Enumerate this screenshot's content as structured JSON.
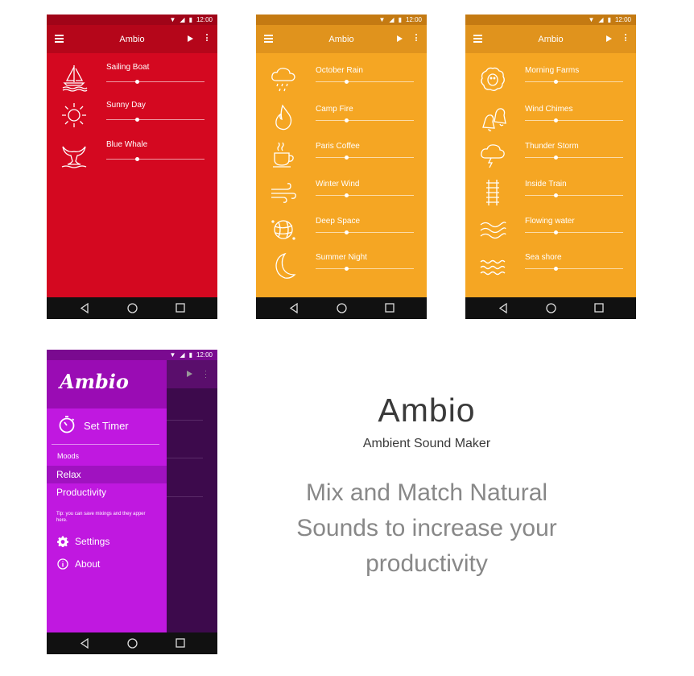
{
  "status_time": "12:00",
  "app_title": "Ambio",
  "screens": [
    {
      "bg": "#d40820",
      "bar": "#b5061a",
      "items": [
        {
          "label": "Sailing Boat",
          "icon": "sailboat-icon"
        },
        {
          "label": "Sunny Day",
          "icon": "sun-icon"
        },
        {
          "label": "Blue Whale",
          "icon": "whale-tail-icon"
        }
      ]
    },
    {
      "bg": "#f5a623",
      "bar": "#d9891a",
      "items": [
        {
          "label": "October Rain",
          "icon": "rain-cloud-icon"
        },
        {
          "label": "Camp Fire",
          "icon": "fire-icon"
        },
        {
          "label": "Paris Coffee",
          "icon": "coffee-cup-icon"
        },
        {
          "label": "Winter Wind",
          "icon": "wind-icon"
        },
        {
          "label": "Deep Space",
          "icon": "planet-icon"
        },
        {
          "label": "Summer Night",
          "icon": "moon-icon"
        }
      ]
    },
    {
      "bg": "#f5a623",
      "bar": "#d9891a",
      "items": [
        {
          "label": "Morning Farms",
          "icon": "sheep-icon"
        },
        {
          "label": "Wind Chimes",
          "icon": "bells-icon"
        },
        {
          "label": "Thunder Storm",
          "icon": "storm-cloud-icon"
        },
        {
          "label": "Inside Train",
          "icon": "train-track-icon"
        },
        {
          "label": "Flowing water",
          "icon": "water-waves-icon"
        },
        {
          "label": "Sea shore",
          "icon": "sea-waves-icon"
        }
      ]
    }
  ],
  "drawer": {
    "logo": "Ambio",
    "set_timer": "Set Timer",
    "moods_header": "Moods",
    "moods": [
      "Relax",
      "Productivity"
    ],
    "tip": "Tip: you can save mixings and they apper here.",
    "settings": "Settings",
    "about": "About"
  },
  "hero": {
    "title": "Ambio",
    "subtitle": "Ambient Sound Maker",
    "tagline_1": "Mix and Match Natural",
    "tagline_2": "Sounds to increase your",
    "tagline_3": "productivity"
  }
}
